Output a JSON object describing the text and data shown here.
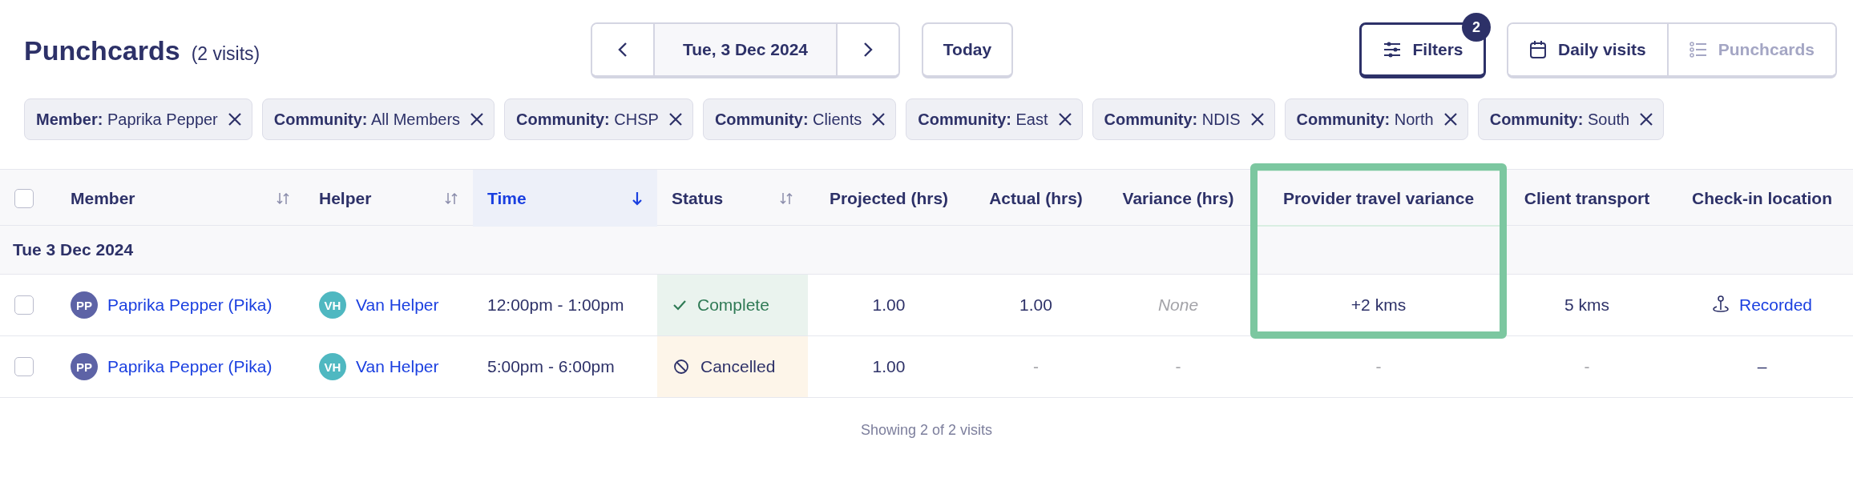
{
  "header": {
    "title": "Punchcards",
    "count": "(2 visits)"
  },
  "date_nav": {
    "date": "Tue, 3 Dec 2024",
    "today": "Today"
  },
  "filters_button": {
    "label": "Filters",
    "badge": "2"
  },
  "view_toggle": [
    {
      "label": "Daily visits",
      "selected": true
    },
    {
      "label": "Punchcards",
      "selected": false
    }
  ],
  "chips": [
    {
      "key": "Member:",
      "value": "Paprika Pepper"
    },
    {
      "key": "Community:",
      "value": "All Members"
    },
    {
      "key": "Community:",
      "value": "CHSP"
    },
    {
      "key": "Community:",
      "value": "Clients"
    },
    {
      "key": "Community:",
      "value": "East"
    },
    {
      "key": "Community:",
      "value": "NDIS"
    },
    {
      "key": "Community:",
      "value": "North"
    },
    {
      "key": "Community:",
      "value": "South"
    }
  ],
  "table": {
    "select_all_checked": false,
    "columns": [
      {
        "label": "Member",
        "sortable": true,
        "sorted": false,
        "highlighted": false
      },
      {
        "label": "Helper",
        "sortable": true,
        "sorted": false,
        "highlighted": false
      },
      {
        "label": "Time",
        "sortable": true,
        "sorted": true,
        "highlighted": false
      },
      {
        "label": "Status",
        "sortable": true,
        "sorted": false,
        "highlighted": false
      },
      {
        "label": "Projected (hrs)",
        "highlighted": false
      },
      {
        "label": "Actual (hrs)",
        "highlighted": false
      },
      {
        "label": "Variance (hrs)",
        "highlighted": false
      },
      {
        "label": "Provider travel variance",
        "highlighted": true
      },
      {
        "label": "Client transport",
        "highlighted": false
      },
      {
        "label": "Check-in location",
        "highlighted": false
      }
    ],
    "group": "Tue 3 Dec 2024",
    "rows": [
      {
        "checked": false,
        "member": {
          "initials": "PP",
          "name": "Paprika Pepper (Pika)"
        },
        "helper": {
          "initials": "VH",
          "name": "Van Helper"
        },
        "time": "12:00pm - 1:00pm",
        "status": {
          "kind": "complete",
          "label": "Complete"
        },
        "projected": "1.00",
        "actual": "1.00",
        "variance": {
          "kind": "none",
          "text": "None"
        },
        "travel": {
          "kind": "value",
          "text": "+2 kms"
        },
        "transport": {
          "kind": "value",
          "text": "5 kms"
        },
        "checkin": {
          "kind": "link",
          "text": "Recorded"
        }
      },
      {
        "checked": false,
        "member": {
          "initials": "PP",
          "name": "Paprika Pepper (Pika)"
        },
        "helper": {
          "initials": "VH",
          "name": "Van Helper"
        },
        "time": "5:00pm - 6:00pm",
        "status": {
          "kind": "cancelled",
          "label": "Cancelled"
        },
        "projected": "1.00",
        "actual": "-",
        "variance": {
          "kind": "empty",
          "text": "-"
        },
        "travel": {
          "kind": "empty",
          "text": "-"
        },
        "transport": {
          "kind": "empty",
          "text": "-"
        },
        "checkin": {
          "kind": "dash",
          "text": "–"
        }
      }
    ]
  },
  "footer": "Showing 2 of 2 visits"
}
